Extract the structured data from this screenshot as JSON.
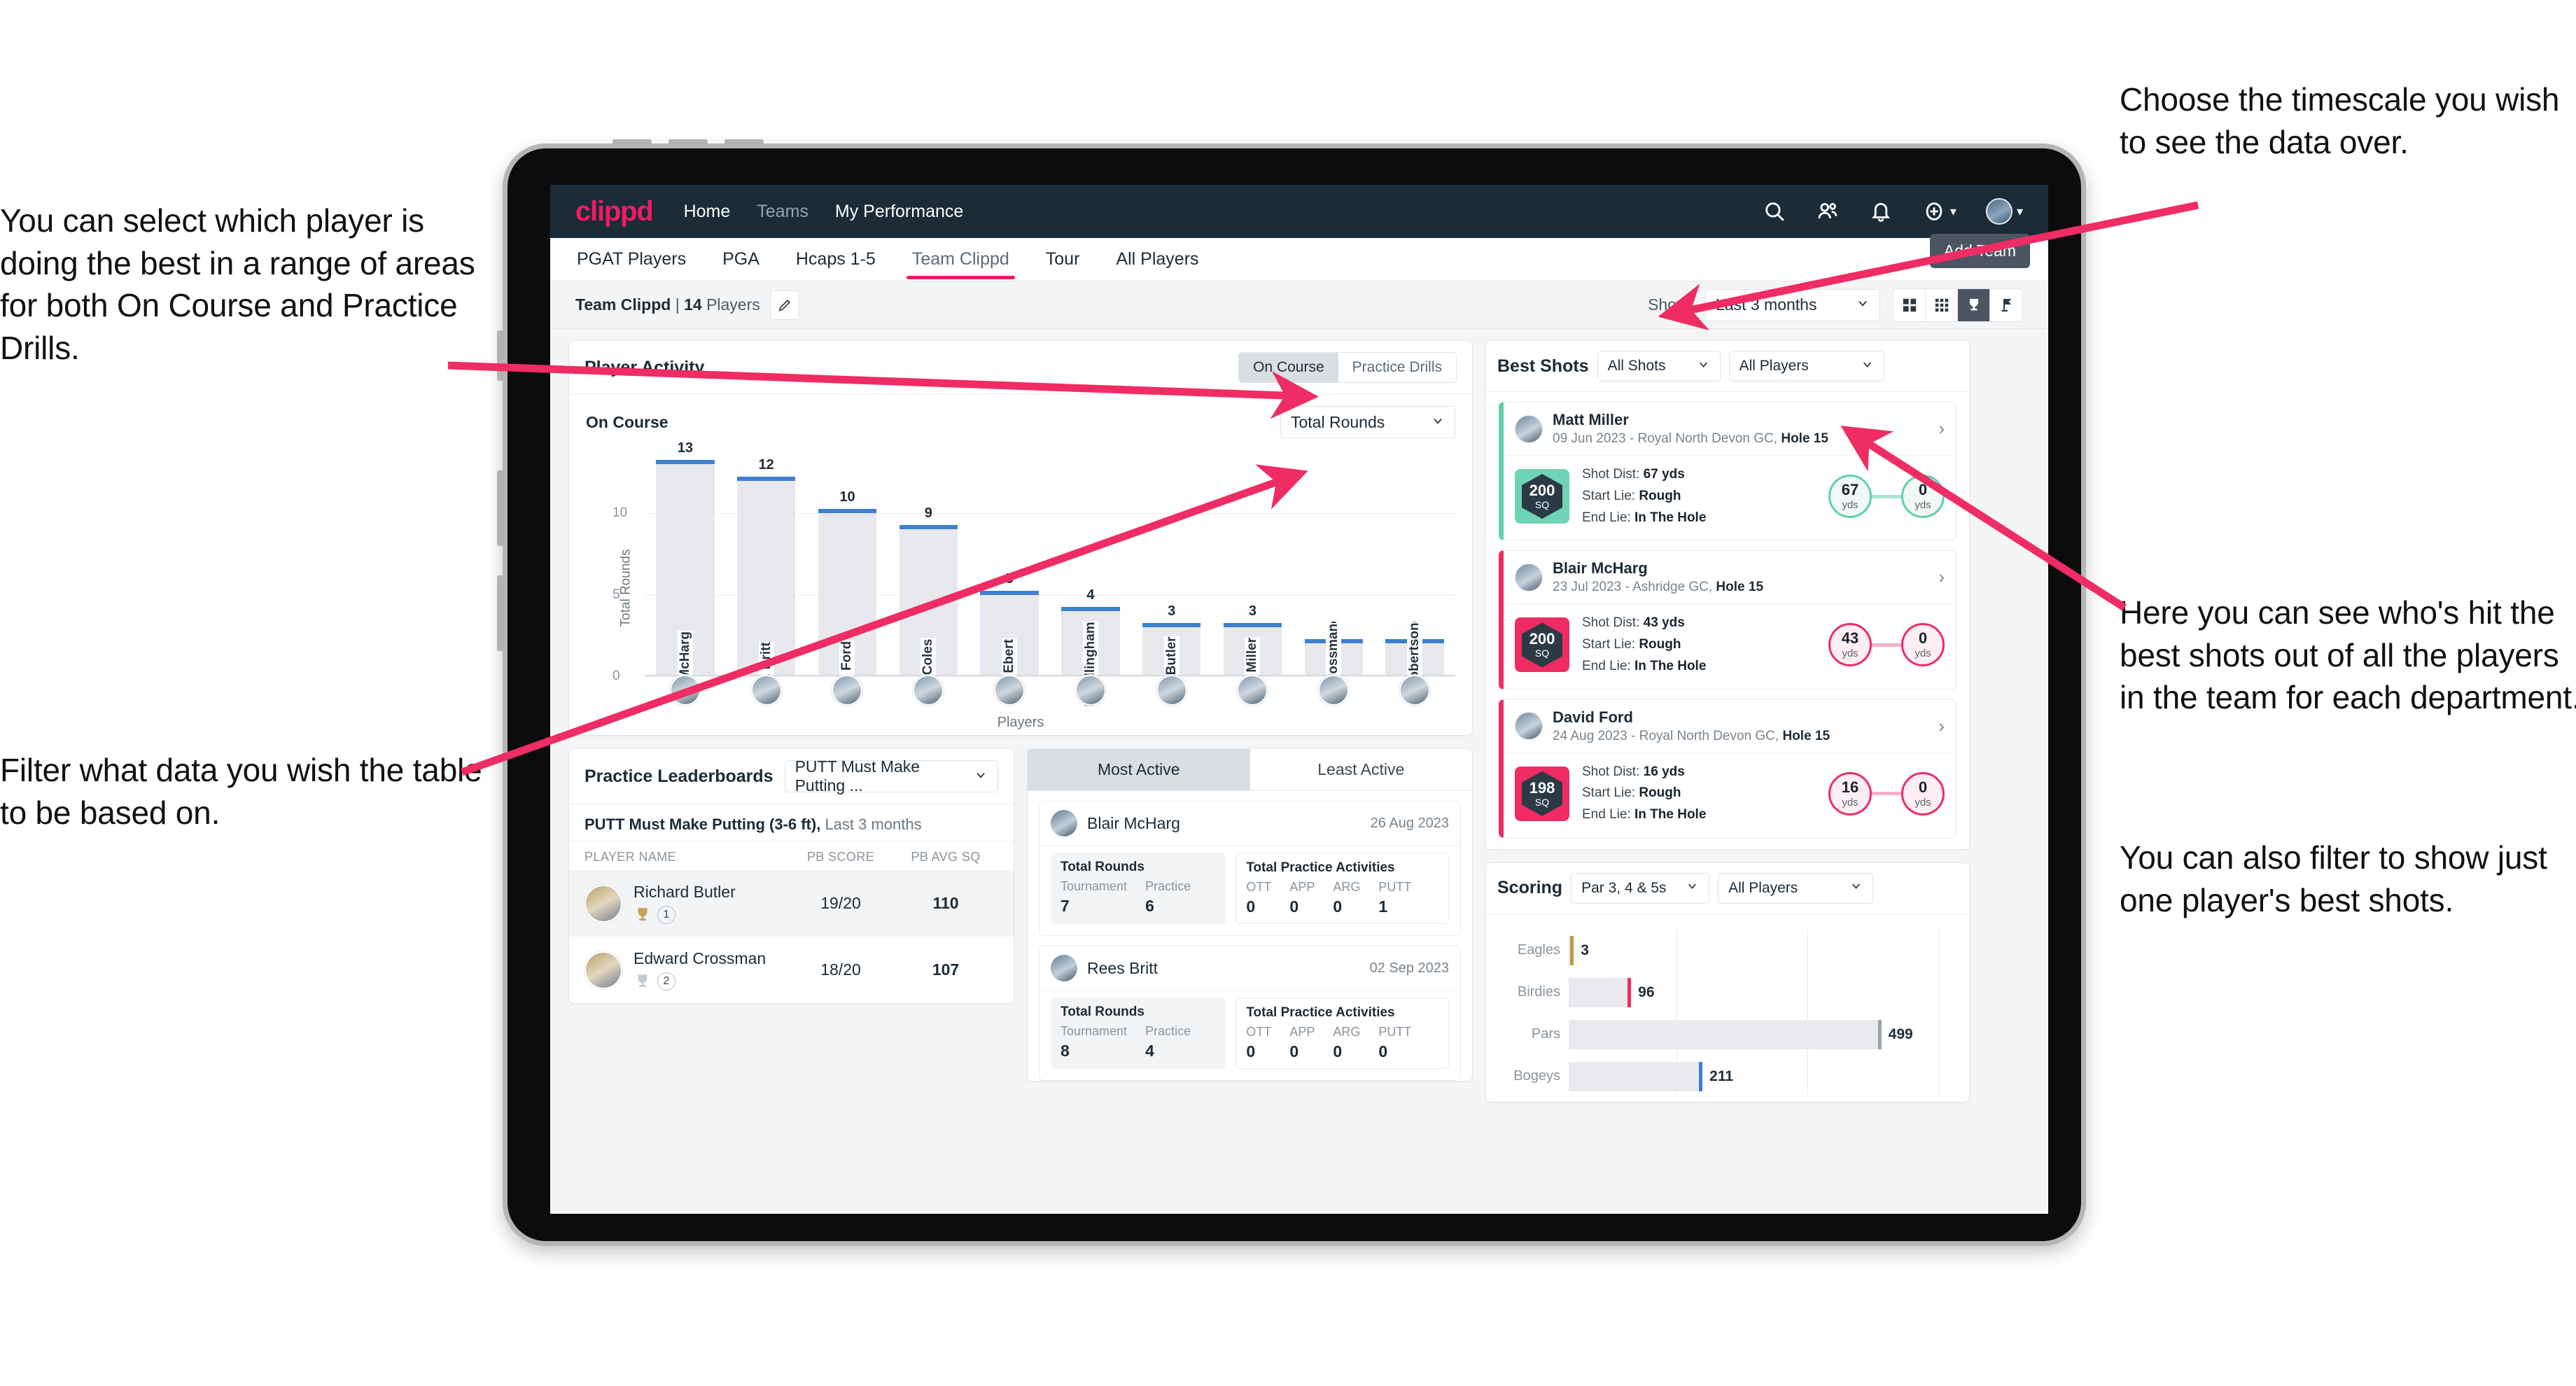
{
  "annotations": {
    "left_top": "You can select which player is doing the best in a range of areas for both On Course and Practice Drills.",
    "left_bottom": "Filter what data you wish the table to be based on.",
    "right_top": "Choose the timescale you wish to see the data over.",
    "right_middle": "Here you can see who's hit the best shots out of all the players in the team for each department.",
    "right_bottom": "You can also filter to show just one player's best shots."
  },
  "topnav": {
    "logo": "clippd",
    "links": [
      {
        "label": "Home",
        "dim": false
      },
      {
        "label": "Teams",
        "dim": true
      },
      {
        "label": "My Performance",
        "dim": false
      }
    ],
    "icons": [
      "search-icon",
      "people-icon",
      "bell-icon",
      "plus-circle-icon",
      "avatar"
    ]
  },
  "tabs": [
    {
      "label": "PGAT Players",
      "active": false
    },
    {
      "label": "PGA",
      "active": false
    },
    {
      "label": "Hcaps 1-5",
      "active": false
    },
    {
      "label": "Team Clippd",
      "active": true
    },
    {
      "label": "Tour",
      "active": false
    },
    {
      "label": "All Players",
      "active": false
    }
  ],
  "tooltip": {
    "add_team": "Add Team"
  },
  "toolbar": {
    "team_name": "Team Clippd",
    "separator": "|",
    "player_count": "14",
    "players_word": "Players",
    "edit_icon": "pencil-icon",
    "show_label": "Show:",
    "timescale_value": "Last 3 months",
    "view_icons": [
      "grid-large-icon",
      "grid-small-icon",
      "trophy-icon",
      "flag-icon"
    ]
  },
  "player_activity": {
    "title": "Player Activity",
    "toggle": [
      {
        "label": "On Course",
        "active": true
      },
      {
        "label": "Practice Drills",
        "active": false
      }
    ],
    "sub_title": "On Course",
    "metric_select": "Total Rounds"
  },
  "chart_data": {
    "type": "bar",
    "title": "Player Activity - On Course",
    "xlabel": "Players",
    "ylabel": "Total Rounds",
    "ylim": [
      0,
      14
    ],
    "yticks": [
      0,
      5,
      10
    ],
    "grid": true,
    "categories": [
      "B. McHarg",
      "R. Britt",
      "D. Ford",
      "J. Coles",
      "E. Ebert",
      "D. Billingham",
      "R. Butler",
      "M. Miller",
      "E. Crossman",
      "C. Robertson"
    ],
    "values": [
      13,
      12,
      10,
      9,
      5,
      4,
      3,
      3,
      2,
      2
    ],
    "bar_color": "#e6e8ec",
    "cap_color": "#3f7fd0"
  },
  "best_shots": {
    "title": "Best Shots",
    "shot_filter": "All Shots",
    "player_filter": "All Players",
    "cards": [
      {
        "name": "Matt Miller",
        "meta_prefix": "09 Jun 2023 - Royal North Devon GC, ",
        "hole": "Hole 15",
        "badge_number": "200",
        "badge_unit": "SQ",
        "accent": "#6fd3b6",
        "shot_dist_label": "Shot Dist: ",
        "shot_dist_value": "67 yds",
        "start_lie_label": "Start Lie: ",
        "start_lie_value": "Rough",
        "end_lie_label": "End Lie: ",
        "end_lie_value": "In The Hole",
        "from_value": "67",
        "from_unit": "yds",
        "to_value": "0",
        "to_unit": "yds"
      },
      {
        "name": "Blair McHarg",
        "meta_prefix": "23 Jul 2023 - Ashridge GC, ",
        "hole": "Hole 15",
        "badge_number": "200",
        "badge_unit": "SQ",
        "accent": "#ef2c63",
        "shot_dist_label": "Shot Dist: ",
        "shot_dist_value": "43 yds",
        "start_lie_label": "Start Lie: ",
        "start_lie_value": "Rough",
        "end_lie_label": "End Lie: ",
        "end_lie_value": "In The Hole",
        "from_value": "43",
        "from_unit": "yds",
        "to_value": "0",
        "to_unit": "yds"
      },
      {
        "name": "David Ford",
        "meta_prefix": "24 Aug 2023 - Royal North Devon GC, ",
        "hole": "Hole 15",
        "badge_number": "198",
        "badge_unit": "SQ",
        "accent": "#ef2c63",
        "shot_dist_label": "Shot Dist: ",
        "shot_dist_value": "16 yds",
        "start_lie_label": "Start Lie: ",
        "start_lie_value": "Rough",
        "end_lie_label": "End Lie: ",
        "end_lie_value": "In The Hole",
        "from_value": "16",
        "from_unit": "yds",
        "to_value": "0",
        "to_unit": "yds"
      }
    ]
  },
  "practice_leaderboards": {
    "title": "Practice Leaderboards",
    "drill_select": "PUTT Must Make Putting ...",
    "sub_title": "PUTT Must Make Putting (3-6 ft),",
    "sub_period": " Last 3 months",
    "columns": [
      "PLAYER NAME",
      "PB SCORE",
      "PB AVG SQ"
    ],
    "rows": [
      {
        "name": "Richard Butler",
        "rank": "1",
        "trophy": "gold",
        "pb_score": "19/20",
        "pb_avg_sq": "110"
      },
      {
        "name": "Edward Crossman",
        "rank": "2",
        "trophy": "silver",
        "pb_score": "18/20",
        "pb_avg_sq": "107"
      }
    ]
  },
  "activity_panel": {
    "tabs": [
      {
        "label": "Most Active",
        "active": true
      },
      {
        "label": "Least Active",
        "active": false
      }
    ],
    "cards": [
      {
        "name": "Blair McHarg",
        "date": "26 Aug 2023",
        "rounds_title": "Total Rounds",
        "rounds_cols": [
          "Tournament",
          "Practice"
        ],
        "rounds_vals": [
          "7",
          "6"
        ],
        "practice_title": "Total Practice Activities",
        "practice_cols": [
          "OTT",
          "APP",
          "ARG",
          "PUTT"
        ],
        "practice_vals": [
          "0",
          "0",
          "0",
          "1"
        ]
      },
      {
        "name": "Rees Britt",
        "date": "02 Sep 2023",
        "rounds_title": "Total Rounds",
        "rounds_cols": [
          "Tournament",
          "Practice"
        ],
        "rounds_vals": [
          "8",
          "4"
        ],
        "practice_title": "Total Practice Activities",
        "practice_cols": [
          "OTT",
          "APP",
          "ARG",
          "PUTT"
        ],
        "practice_vals": [
          "0",
          "0",
          "0",
          "0"
        ]
      }
    ]
  },
  "scoring": {
    "title": "Scoring",
    "par_filter": "Par 3, 4 & 5s",
    "player_filter": "All Players",
    "chart": {
      "type": "bar",
      "orientation": "horizontal",
      "categories": [
        "Eagles",
        "Birdies",
        "Pars",
        "Bogeys"
      ],
      "values": [
        3,
        96,
        499,
        211
      ],
      "xmax": 620,
      "colors": [
        "#c49a3f",
        "#ef2c63",
        "#9aa4ad",
        "#3f7fd0"
      ],
      "grid": true
    }
  },
  "colors": {
    "brand_pink": "#ef1b63",
    "nav_dark": "#1b2b38",
    "accent_blue": "#3f7fd0",
    "accent_teal": "#6fd3b6",
    "annotation_arrow": "#ef2c63"
  }
}
